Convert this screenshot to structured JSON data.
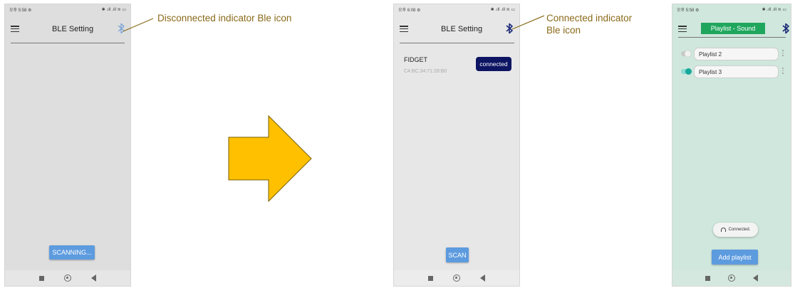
{
  "colors": {
    "accent_blue": "#5d9bdf",
    "navy": "#0d1563",
    "playlist_green": "#1fa65d",
    "ble_icon_disconnected": "#7fa6d6",
    "ble_icon_connected": "#1b2a78",
    "annotation_text": "#8a6a1a",
    "arrow_fill": "#ffc000"
  },
  "phone1": {
    "status_time": "오후 5:58 ⚙",
    "status_icons": "✱ .ıll .ıll ≋ ▭",
    "title": "BLE Setting",
    "ble_icon": "bluetooth-disconnected-icon",
    "scan_button": "SCANNING..."
  },
  "annotation_disconnected": "Disconnected indicator Ble icon",
  "phone2": {
    "status_time": "오후 6:08 ⚙",
    "status_icons": "✱ .ıll .ıll ≋ ▭",
    "title": "BLE Setting",
    "ble_icon": "bluetooth-connected-icon",
    "device": {
      "name": "FIDGET",
      "mac": "C4:BC:34:71:28:B0",
      "status": "connected"
    },
    "scan_button": "SCAN"
  },
  "annotation_connected": {
    "line1": "Connected indicator",
    "line2": "Ble icon"
  },
  "phone3": {
    "status_time": "오후 5:58 ⚙",
    "status_icons": "✱ .ıll .ıll ≋ ▭",
    "title": "Playlist - Sound",
    "ble_icon": "bluetooth-connected-icon",
    "playlists": [
      {
        "name": "Playlist 2",
        "enabled": false
      },
      {
        "name": "Playlist 3",
        "enabled": true
      }
    ],
    "toast": "Connected.",
    "add_button": "Add playlist"
  }
}
